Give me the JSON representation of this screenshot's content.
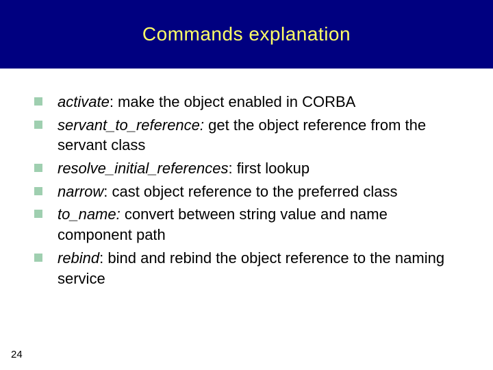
{
  "header": {
    "title": "Commands explanation"
  },
  "items": [
    {
      "term": "activate",
      "desc": ": make the object enabled in CORBA"
    },
    {
      "term": "servant_to_reference:",
      "desc": " get the object reference from the servant class"
    },
    {
      "term": "resolve_initial_references",
      "desc": ": first lookup"
    },
    {
      "term": "narrow",
      "desc": ": cast object reference to the preferred class"
    },
    {
      "term": "to_name:",
      "desc": " convert between string value and name component path"
    },
    {
      "term": "rebind",
      "desc": ": bind and rebind the object reference to the naming service"
    }
  ],
  "page_number": "24"
}
